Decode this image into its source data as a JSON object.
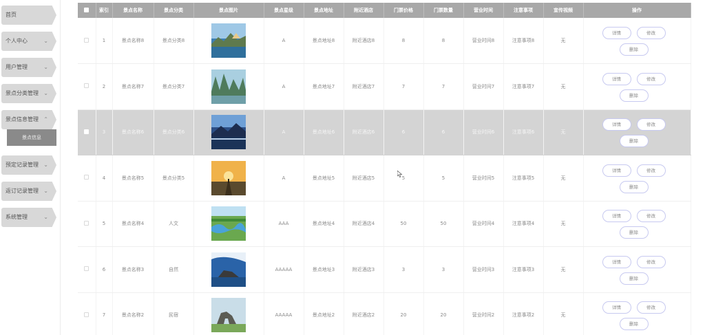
{
  "sidebar": {
    "items": [
      {
        "label": "首页",
        "chevron": ""
      },
      {
        "label": "个人中心",
        "chevron": "⌄"
      },
      {
        "label": "用户管理",
        "chevron": "⌄"
      },
      {
        "label": "景点分类管理",
        "chevron": "⌄"
      },
      {
        "label": "景点信息管理",
        "chevron": "⌃"
      },
      {
        "label": "预定记录管理",
        "chevron": "⌄"
      },
      {
        "label": "返订记录管理",
        "chevron": "⌄"
      },
      {
        "label": "系统管理",
        "chevron": "⌄"
      }
    ],
    "sub_item": {
      "label": "景点信息"
    }
  },
  "table": {
    "headers": [
      "索引",
      "景点名称",
      "景点分类",
      "景点图片",
      "景点星级",
      "景点地址",
      "附近酒店",
      "门票价格",
      "门票数量",
      "营业时间",
      "注意事项",
      "宣传视频",
      "操作"
    ],
    "rows": [
      {
        "index": "1",
        "name": "景点名称8",
        "category": "景点分类8",
        "star": "A",
        "address": "景点地址8",
        "hotel": "附近酒店8",
        "price": "8",
        "quantity": "8",
        "hours": "营业时间8",
        "notes": "注意事项8",
        "video": "无",
        "image": "landscape-lake-sunset"
      },
      {
        "index": "2",
        "name": "景点名称7",
        "category": "景点分类7",
        "star": "A",
        "address": "景点地址7",
        "hotel": "附近酒店7",
        "price": "7",
        "quantity": "7",
        "hours": "营业时间7",
        "notes": "注意事项7",
        "video": "无",
        "image": "karst-mountains-river"
      },
      {
        "index": "3",
        "name": "景点名称6",
        "category": "景点分类6",
        "star": "A",
        "address": "景点地址6",
        "hotel": "附近酒店6",
        "price": "6",
        "quantity": "6",
        "hours": "营业时间6",
        "notes": "注意事项6",
        "video": "无",
        "image": "mountain-lake-dusk"
      },
      {
        "index": "4",
        "name": "景点名称5",
        "category": "景点分类5",
        "star": "A",
        "address": "景点地址5",
        "hotel": "附近酒店5",
        "price": "5",
        "quantity": "5",
        "hours": "营业时间5",
        "notes": "注意事项5",
        "video": "无",
        "image": "sunset-figure"
      },
      {
        "index": "5",
        "name": "景点名称4",
        "category": "人文",
        "star": "AAA",
        "address": "景点地址4",
        "hotel": "附近酒店4",
        "price": "50",
        "quantity": "50",
        "hours": "营业时间4",
        "notes": "注意事项4",
        "video": "无",
        "image": "grassland-river"
      },
      {
        "index": "6",
        "name": "景点名称3",
        "category": "自然",
        "star": "AAAAA",
        "address": "景点地址3",
        "hotel": "附近酒店3",
        "price": "3",
        "quantity": "3",
        "hours": "营业时间3",
        "notes": "注意事项3",
        "video": "无",
        "image": "sea-rock-blue-sky"
      },
      {
        "index": "7",
        "name": "景点名称2",
        "category": "民宿",
        "star": "AAAAA",
        "address": "景点地址2",
        "hotel": "附近酒店2",
        "price": "20",
        "quantity": "20",
        "hours": "营业时间2",
        "notes": "注意事项2",
        "video": "无",
        "image": "rock-arch-coast"
      }
    ],
    "selected_row": 2,
    "actions": {
      "detail": "详情",
      "edit": "修改",
      "delete": "删除"
    }
  },
  "colors": {
    "header_bg": "#a8a8a8",
    "selected_row_bg": "#d4d4d4",
    "menu_bg": "#d8d8d8",
    "sub_item_bg": "#8a8a8a",
    "button_border": "#c7c9f0"
  }
}
